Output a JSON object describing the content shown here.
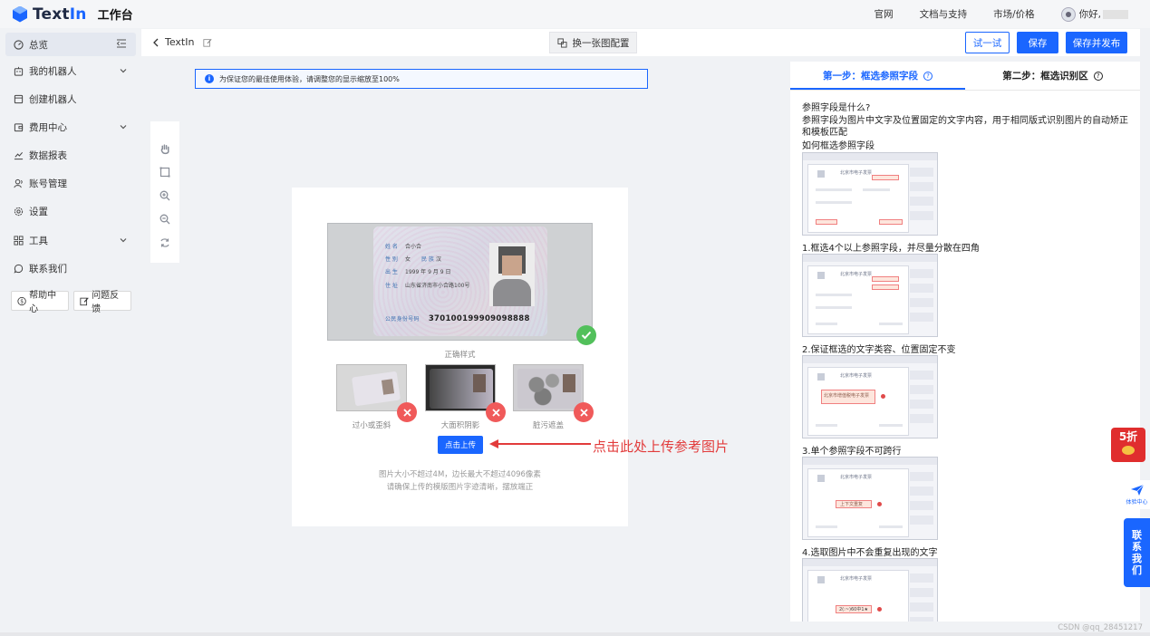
{
  "header": {
    "logo_text_a": "Text",
    "logo_text_b": "In",
    "workspace": "工作台",
    "nav": [
      "官网",
      "文档与支持",
      "市场/价格"
    ],
    "greeting": "你好,"
  },
  "sidebar": {
    "items": [
      {
        "label": "总览",
        "icon": "dashboard-icon"
      },
      {
        "label": "我的机器人",
        "icon": "robot-icon"
      },
      {
        "label": "创建机器人",
        "icon": "create-icon"
      },
      {
        "label": "费用中心",
        "icon": "wallet-icon"
      },
      {
        "label": "数据报表",
        "icon": "chart-icon"
      },
      {
        "label": "账号管理",
        "icon": "account-icon"
      },
      {
        "label": "设置",
        "icon": "gear-icon"
      },
      {
        "label": "工具",
        "icon": "grid-icon"
      },
      {
        "label": "联系我们",
        "icon": "chat-icon"
      }
    ],
    "help_center": "帮助中心",
    "feedback": "问题反馈"
  },
  "toolbar": {
    "back_label": "TextIn",
    "swap_label": "换一张图配置",
    "try_label": "试一试",
    "save_label": "保存",
    "publish_label": "保存并发布"
  },
  "canvas": {
    "notice": "为保证您的最佳使用体验，请调整您的显示缩放至100%",
    "idcard": {
      "name_k": "姓 名",
      "name_v": "合小合",
      "sex_k": "性 别",
      "sex_v": "女",
      "nation_k": "民 族",
      "nation_v": "汉",
      "birth_k": "出 生",
      "birth_v": "1999 年 9 月 9 日",
      "addr_k": "住 址",
      "addr_v": "山东省济南市小合路100号",
      "num_k": "公民身份号码",
      "num_v": "370100199909098888"
    },
    "correct_label": "正确样式",
    "bad_labels": [
      "过小或歪斜",
      "大面积阴影",
      "脏污遮盖"
    ],
    "upload_button": "点击上传",
    "annotation": "点击此处上传参考图片",
    "tip_line1": "图片大小不超过4M，边长最大不超过4096像素",
    "tip_line2": "请确保上传的模版图片字迹清晰，摆放端正"
  },
  "right_panel": {
    "tab1": "第一步：框选参照字段",
    "tab2": "第二步：框选识别区",
    "q1": "参照字段是什么?",
    "desc": "参照字段为图片中文字及位置固定的文字内容，用于相同版式识别图片的自动矫正和模板匹配",
    "how": "如何框选参照字段",
    "rule1": "1.框选4个以上参照字段，并尽量分散在四角",
    "rule2": "2.保证框选的文字类容、位置固定不变",
    "rule3": "3.单个参照字段不可跨行",
    "rule4": "4.选取图片中不会重复出现的文字",
    "sample_title": "北京市电子发票",
    "sample_box2": "北京市增值税电子发票",
    "sample_box3": "上下文重复",
    "sample_box4": "2(:~)60中1★"
  },
  "floating": {
    "promo": "5折",
    "plane_caption": "体验中心",
    "contact": [
      "联",
      "系",
      "我",
      "们"
    ]
  },
  "watermark": "CSDN @qq_28451217",
  "colors": {
    "accent": "#1a66ff",
    "success": "#52c05b",
    "danger": "#f05a5a",
    "annotation": "#e23b3b"
  }
}
